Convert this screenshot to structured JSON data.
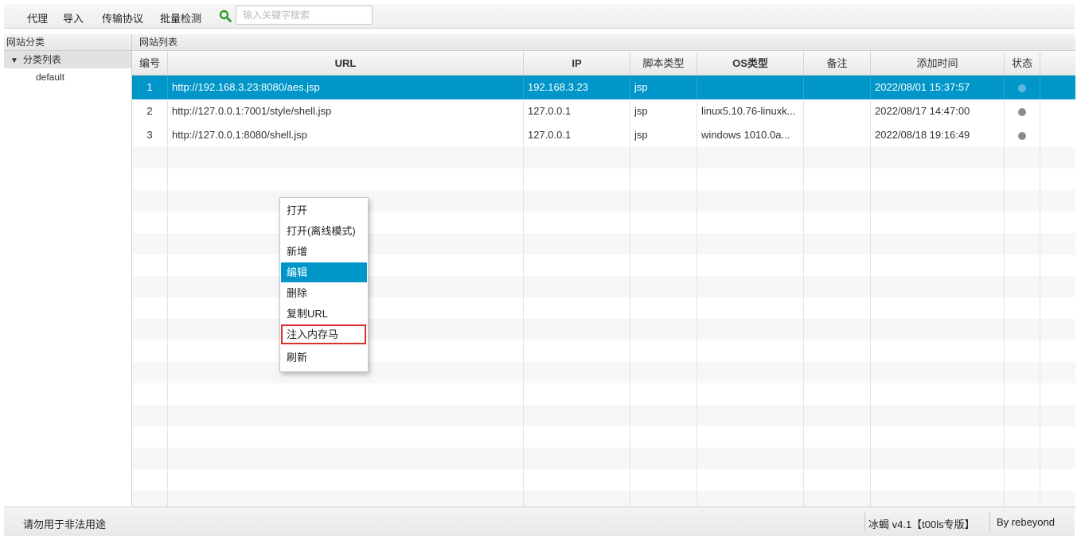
{
  "toolbar": {
    "proxy": "代理",
    "import": "导入",
    "protocol": "传输协议",
    "batch_check": "批量检测",
    "search_placeholder": "输入关键字搜索"
  },
  "left_panel": {
    "header": "网站分类",
    "tree_root": "分类列表",
    "tree_child": "default"
  },
  "right_panel": {
    "header": "网站列表",
    "columns": [
      "编号",
      "URL",
      "IP",
      "脚本类型",
      "OS类型",
      "备注",
      "添加时间",
      "状态"
    ]
  },
  "rows": [
    {
      "id": "1",
      "url": "http://192.168.3.23:8080/aes.jsp",
      "ip": "192.168.3.23",
      "script": "jsp",
      "os": "",
      "note": "",
      "time": "2022/08/01 15:37:57",
      "selected": true
    },
    {
      "id": "2",
      "url": "http://127.0.0.1:7001/style/shell.jsp",
      "ip": "127.0.0.1",
      "script": "jsp",
      "os": "linux5.10.76-linuxk...",
      "note": "",
      "time": "2022/08/17 14:47:00",
      "selected": false
    },
    {
      "id": "3",
      "url": "http://127.0.0.1:8080/shell.jsp",
      "ip": "127.0.0.1",
      "script": "jsp",
      "os": "windows 1010.0a...",
      "note": "",
      "time": "2022/08/18 19:16:49",
      "selected": false
    }
  ],
  "context_menu": {
    "items": [
      "打开",
      "打开(离线模式)",
      "新增",
      "编辑",
      "删除",
      "复制URL",
      "注入内存马",
      "刷新"
    ],
    "highlighted": "编辑",
    "boxed": "注入内存马",
    "boxed_color": "#d9302e"
  },
  "statusbar": {
    "left": "请勿用于非法用途",
    "version": "冰蝎 v4.1【t00ls专版】",
    "author": "By rebeyond"
  },
  "colors": {
    "selection": "#0096c9",
    "status_dot": "#8c8c8c",
    "search_icon": "#2e9e2e"
  },
  "icons": {
    "search": "search-icon",
    "tree_toggle": "triangle-down-icon",
    "status": "status-dot-icon"
  }
}
